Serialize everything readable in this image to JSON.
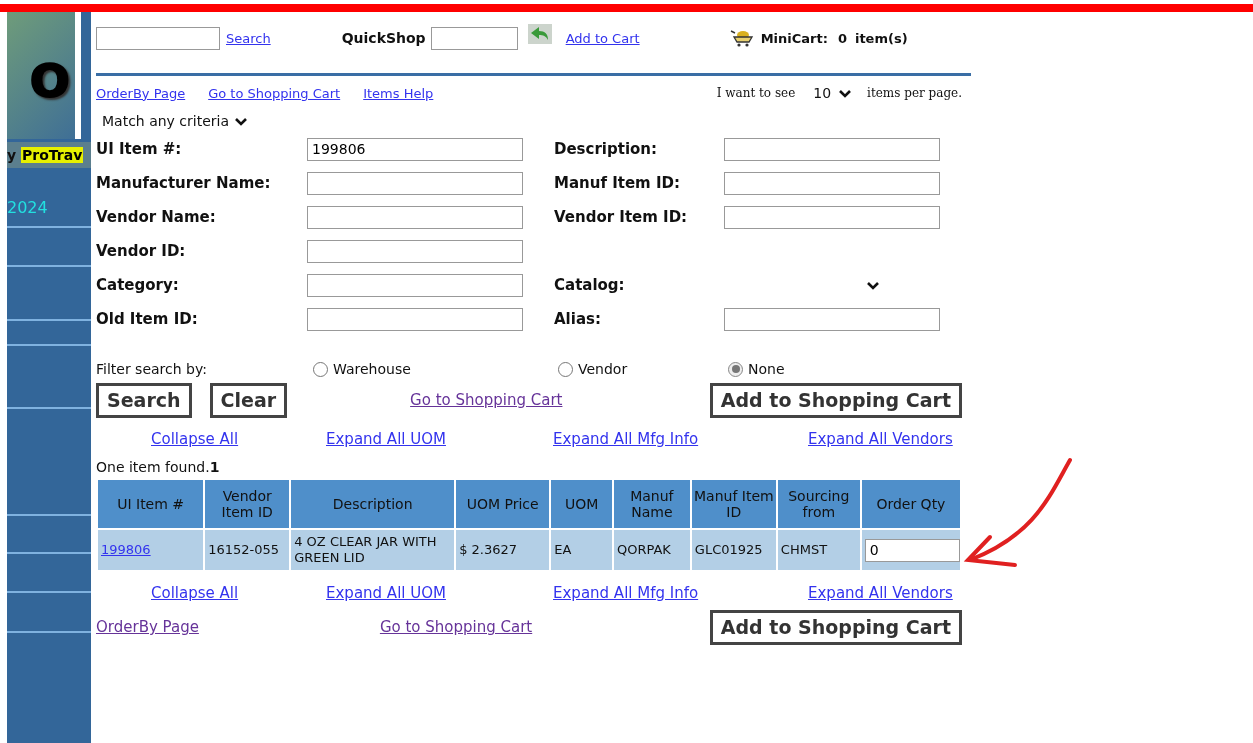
{
  "sidebar": {
    "logo_text": "o",
    "tagline_lead": "y",
    "tagline_highlight": "ProTrav",
    "year": "2024"
  },
  "header": {
    "search_link": "Search",
    "quickshop_label": "QuickShop",
    "add_to_cart_link": "Add to Cart",
    "minicart_label": "MiniCart:",
    "minicart_count": "0",
    "minicart_unit": "item(s)"
  },
  "top_links": [
    "OrderBy Page",
    "Go to Shopping Cart",
    "Items Help"
  ],
  "per_page": {
    "prefix": "I want to see",
    "value": "10",
    "suffix": "items per page."
  },
  "match_mode": "Match any criteria",
  "form_rows": [
    {
      "left": {
        "label": "UI Item #:",
        "value": "199806"
      },
      "right": {
        "label": "Description:",
        "kind": "text"
      }
    },
    {
      "left": {
        "label": "Manufacturer Name:"
      },
      "right": {
        "label": "Manuf Item ID:",
        "kind": "text"
      }
    },
    {
      "left": {
        "label": "Vendor Name:"
      },
      "right": {
        "label": "Vendor Item ID:",
        "kind": "text"
      }
    },
    {
      "left": {
        "label": "Vendor ID:"
      }
    },
    {
      "left": {
        "label": "Category:"
      },
      "right": {
        "label": "Catalog:",
        "kind": "select"
      }
    },
    {
      "left": {
        "label": "Old Item ID:"
      },
      "right": {
        "label": "Alias:",
        "kind": "text"
      }
    }
  ],
  "filter": {
    "label": "Filter search by:",
    "options": [
      {
        "label": "Warehouse",
        "selected": false
      },
      {
        "label": "Vendor",
        "selected": false
      },
      {
        "label": "None",
        "selected": true
      }
    ]
  },
  "actions": {
    "search": "Search",
    "clear": "Clear",
    "cart_link": "Go to Shopping Cart",
    "add": "Add to Shopping Cart"
  },
  "expand_links_top": [
    "Collapse All",
    "Expand All UOM",
    "Expand All Mfg Info",
    "Expand All Vendors"
  ],
  "result_text": "One item found.**1**",
  "table": {
    "columns": [
      "UI Item #",
      "Vendor Item ID",
      "Description",
      "UOM Price",
      "UOM",
      "Manuf Name",
      "Manuf Item ID",
      "Sourcing from",
      "Order Qty"
    ],
    "rows": [
      {
        "cells": [
          {
            "kind": "link",
            "text": "199806"
          },
          {
            "kind": "text",
            "text": "16152-055"
          },
          {
            "kind": "text",
            "text": "4 OZ CLEAR JAR WITH GREEN LID"
          },
          {
            "kind": "text",
            "text": "$ 2.3627"
          },
          {
            "kind": "text",
            "text": "EA"
          },
          {
            "kind": "text",
            "text": "QORPAK"
          },
          {
            "kind": "text",
            "text": "GLC01925"
          },
          {
            "kind": "text",
            "text": "CHMST"
          },
          {
            "kind": "input",
            "text": "0"
          }
        ]
      }
    ]
  },
  "expand_links_bottom": [
    "Collapse All",
    "Expand All UOM",
    "Expand All Mfg Info",
    "Expand All Vendors"
  ],
  "bottom": {
    "orderby": "OrderBy Page",
    "cart_link": "Go to Shopping Cart",
    "add": "Add to Shopping Cart"
  }
}
